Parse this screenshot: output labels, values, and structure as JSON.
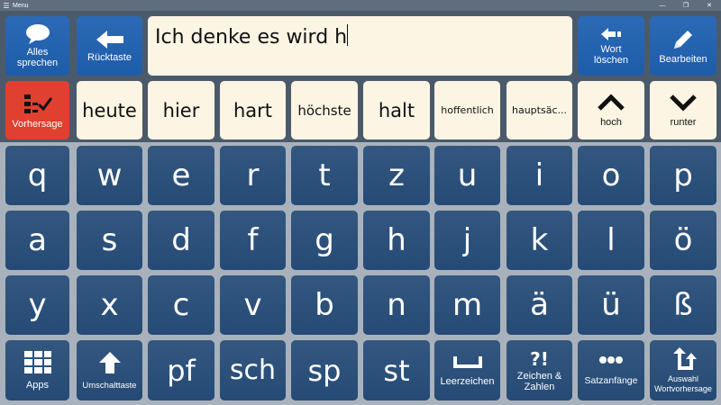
{
  "window": {
    "title": "Menu",
    "minimize": "—",
    "maximize": "❐",
    "close": "✕"
  },
  "toolbar": {
    "speak_all": "Alles sprechen",
    "backspace": "Rücktaste",
    "delete_word": "Wort löschen",
    "edit": "Bearbeiten"
  },
  "message_text": "Ich denke es wird h",
  "prediction": {
    "toggle_label": "Vorhersage",
    "words": [
      "heute",
      "hier",
      "hart",
      "höchste",
      "halt",
      "hoffentlich",
      "hauptsäc..."
    ],
    "up_label": "hoch",
    "down_label": "runter"
  },
  "keyboard": {
    "rows": [
      [
        "q",
        "w",
        "e",
        "r",
        "t",
        "z",
        "u",
        "i",
        "o",
        "p"
      ],
      [
        "a",
        "s",
        "d",
        "f",
        "g",
        "h",
        "j",
        "k",
        "l",
        "ö"
      ],
      [
        "y",
        "x",
        "c",
        "v",
        "b",
        "n",
        "m",
        "ä",
        "ü",
        "ß"
      ]
    ],
    "apps": "Apps",
    "shift": "Umschalttaste",
    "clusters": [
      "pf",
      "sch",
      "sp",
      "st"
    ],
    "space": "Leerzeichen",
    "symbols_glyph": "?!",
    "symbols": "Zeichen & Zahlen",
    "sentence_starters": "Satzanfänge",
    "select_prediction": "Auswahl Wortvorhersage"
  },
  "colors": {
    "accent_blue": "#2166b3",
    "prediction_red": "#e0402f",
    "cream": "#fdf5e4",
    "key_dark": "#2d5179",
    "keyboard_bg": "#a9b2bc"
  }
}
